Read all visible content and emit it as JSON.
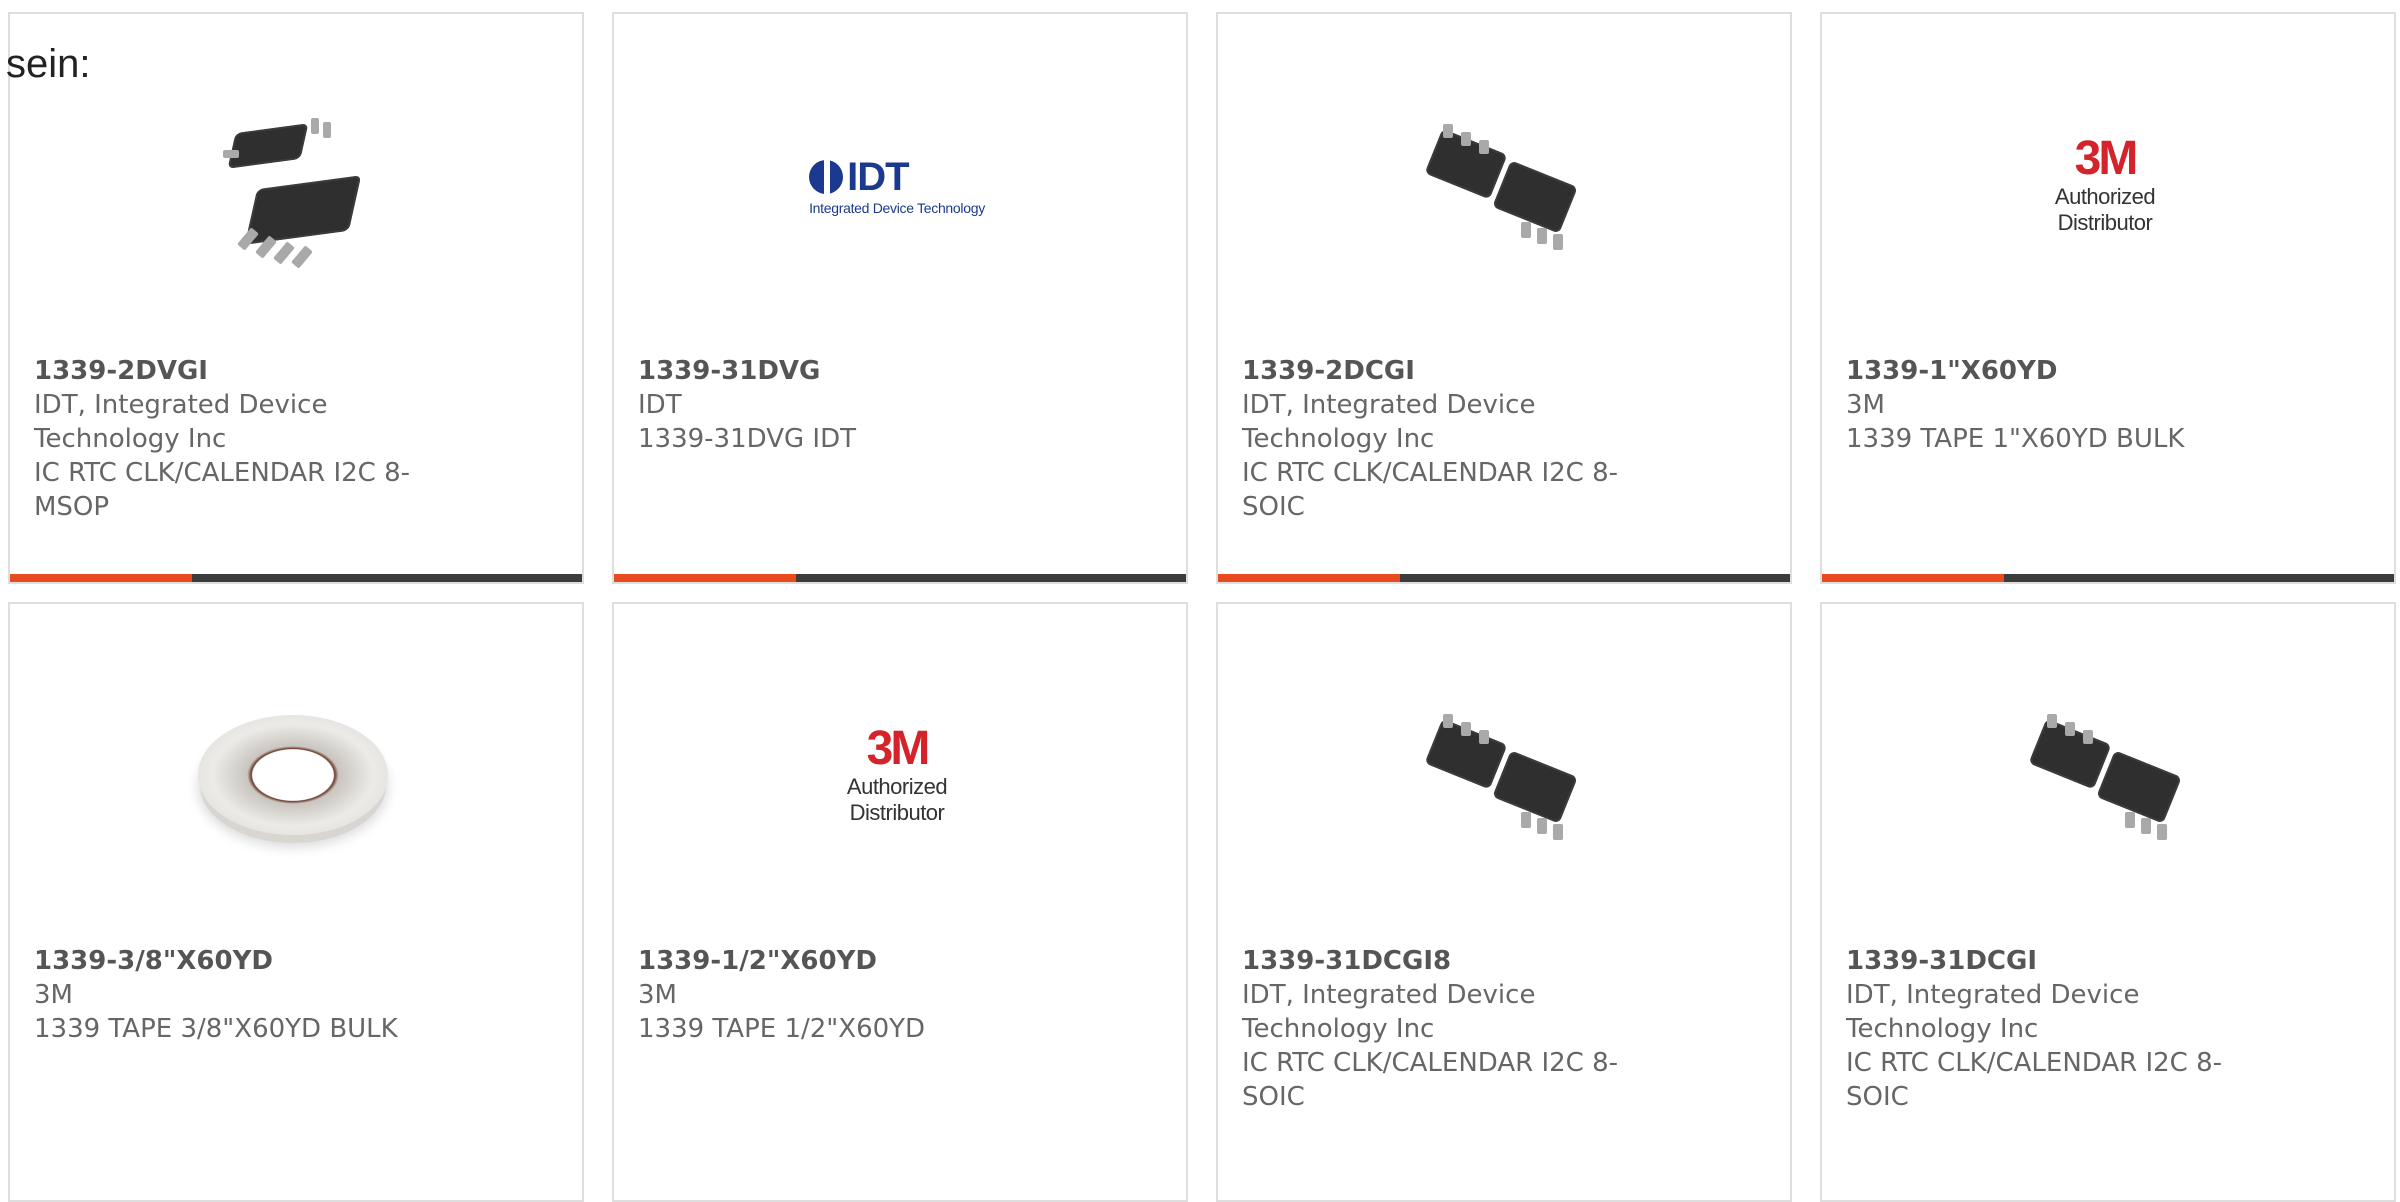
{
  "lead_text": "sein:",
  "products": [
    {
      "part": "1339-2DVGI",
      "manufacturer": "IDT, Integrated Device Technology Inc",
      "description": "IC RTC CLK/CALENDAR I2C 8-MSOP",
      "image": "msop-chip-icon"
    },
    {
      "part": "1339-31DVG",
      "manufacturer": "IDT",
      "description": "1339-31DVG IDT",
      "image": "idt-logo-icon",
      "logo_text": "IDT",
      "logo_subtext": "Integrated Device Technology"
    },
    {
      "part": "1339-2DCGI",
      "manufacturer": "IDT, Integrated Device Technology Inc",
      "description": "IC RTC CLK/CALENDAR I2C 8-SOIC",
      "image": "soic-chip-icon"
    },
    {
      "part": "1339-1\"X60YD",
      "manufacturer": "3M",
      "description": "1339 TAPE 1\"X60YD BULK",
      "image": "3m-logo-icon",
      "logo_text": "3M",
      "logo_subtext": "Authorized Distributor"
    },
    {
      "part": "1339-3/8\"X60YD",
      "manufacturer": "3M",
      "description": "1339 TAPE 3/8\"X60YD BULK",
      "image": "tape-roll-icon"
    },
    {
      "part": "1339-1/2\"X60YD",
      "manufacturer": "3M",
      "description": "1339 TAPE 1/2\"X60YD",
      "image": "3m-logo-icon",
      "logo_text": "3M",
      "logo_subtext": "Authorized Distributor"
    },
    {
      "part": "1339-31DCGI8",
      "manufacturer": "IDT, Integrated Device Technology Inc",
      "description": "IC RTC CLK/CALENDAR I2C 8-SOIC",
      "image": "soic-chip-icon"
    },
    {
      "part": "1339-31DCGI",
      "manufacturer": "IDT, Integrated Device Technology Inc",
      "description": "IC RTC CLK/CALENDAR I2C 8-SOIC",
      "image": "soic-chip-icon"
    }
  ],
  "colors": {
    "accent_bar": "#e84c1e",
    "bar": "#3c3c3c",
    "border": "#dedede",
    "idt_blue": "#1b3a8f",
    "3m_red": "#d4232b"
  }
}
